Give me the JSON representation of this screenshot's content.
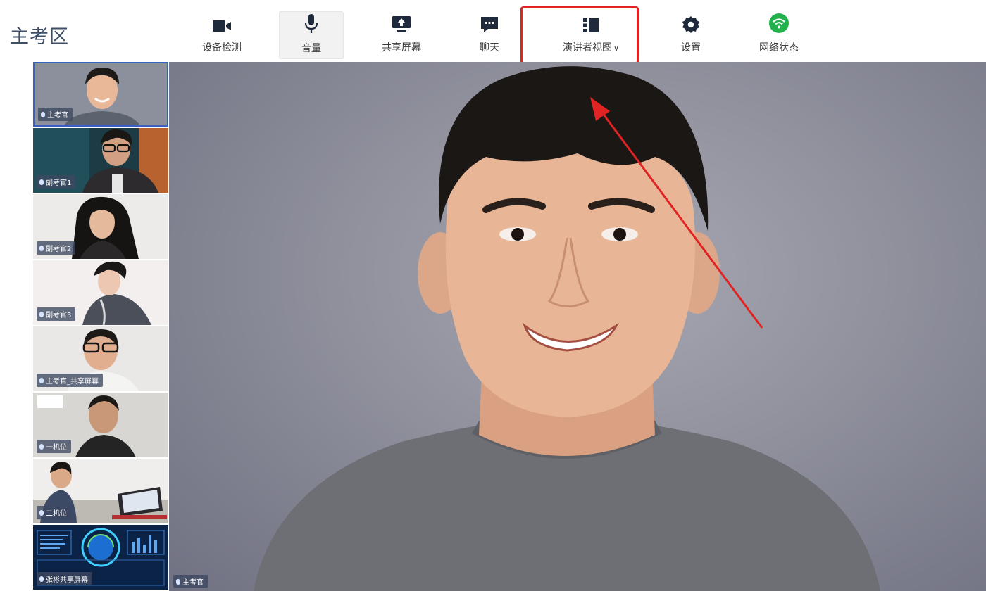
{
  "app": {
    "title": "主考区"
  },
  "toolbar": {
    "items": [
      {
        "label": "设备检测",
        "icon": "camera-icon"
      },
      {
        "label": "音量",
        "icon": "microphone-icon",
        "active": true
      },
      {
        "label": "共享屏幕",
        "icon": "share-screen-icon"
      },
      {
        "label": "聊天",
        "icon": "chat-icon"
      },
      {
        "label": "演讲者视图",
        "icon": "speaker-view-icon",
        "dropdown": true
      },
      {
        "label": "设置",
        "icon": "gear-icon"
      },
      {
        "label": "网络状态",
        "icon": "wifi-icon",
        "color": "#22b14c"
      }
    ]
  },
  "participants": [
    {
      "name": "主考官",
      "selected": true
    },
    {
      "name": "副考官1"
    },
    {
      "name": "副考官2"
    },
    {
      "name": "副考官3"
    },
    {
      "name": "主考官_共享屏幕"
    },
    {
      "name": "一机位"
    },
    {
      "name": "二机位"
    },
    {
      "name": "张彬共享屏幕"
    }
  ],
  "main_video": {
    "name": "主考官"
  },
  "colors": {
    "highlight": "#e02323",
    "selected_border": "#3b5fc0",
    "network_ok": "#22b14c"
  }
}
